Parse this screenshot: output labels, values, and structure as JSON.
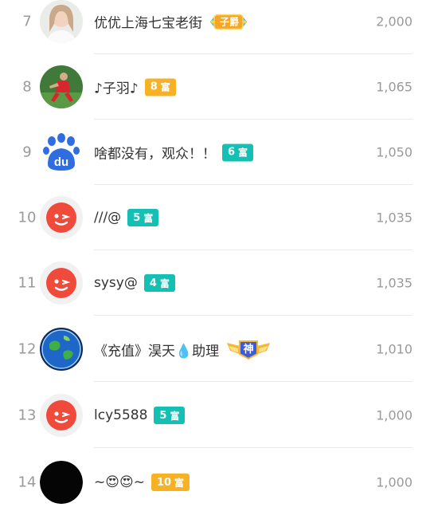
{
  "colors": {
    "badge_orange": "#f6b224",
    "badge_teal": "#14c0b3",
    "baidu_blue": "#2f6de1",
    "red_avatar": "#f04a3b"
  },
  "rows": [
    {
      "rank": "7",
      "name": "优优上海七宝老街",
      "avatar": "photo-girl",
      "badge": {
        "kind": "title",
        "text": "子爵"
      },
      "score": "2,000"
    },
    {
      "rank": "8",
      "name": "♪子羽♪",
      "avatar": "photo-player",
      "badge": {
        "kind": "level",
        "num": "8",
        "fu": "富",
        "color": "#f6b224"
      },
      "score": "1,065"
    },
    {
      "rank": "9",
      "name": "啥都没有，观众！！",
      "avatar": "baidu-paw",
      "badge": {
        "kind": "level",
        "num": "6",
        "fu": "富",
        "color": "#14c0b3"
      },
      "score": "1,050"
    },
    {
      "rank": "10",
      "name": "///@",
      "avatar": "red-wink",
      "badge": {
        "kind": "level",
        "num": "5",
        "fu": "富",
        "color": "#14c0b3"
      },
      "score": "1,035"
    },
    {
      "rank": "11",
      "name": "sysy@",
      "avatar": "red-wink",
      "badge": {
        "kind": "level",
        "num": "4",
        "fu": "富",
        "color": "#14c0b3"
      },
      "score": "1,035"
    },
    {
      "rank": "12",
      "name": "《充值》淏天💧助理",
      "avatar": "globe",
      "badge": {
        "kind": "title",
        "text": "神"
      },
      "score": "1,010"
    },
    {
      "rank": "13",
      "name": "lcy5588",
      "avatar": "red-wink",
      "badge": {
        "kind": "level",
        "num": "5",
        "fu": "富",
        "color": "#14c0b3"
      },
      "score": "1,000"
    },
    {
      "rank": "14",
      "name": "~😍😍~",
      "avatar": "black-circle",
      "badge": {
        "kind": "level",
        "num": "10",
        "fu": "富",
        "color": "#f6b224"
      },
      "score": "1,000"
    }
  ]
}
